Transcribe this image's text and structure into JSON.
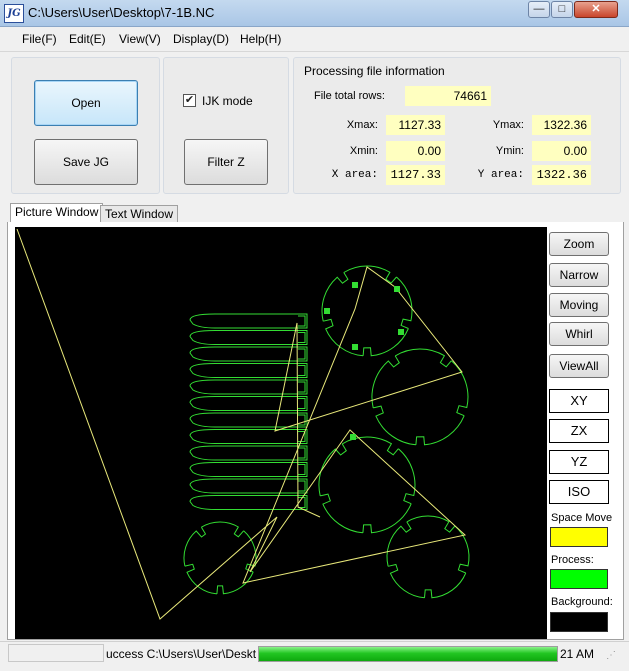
{
  "window": {
    "title": "C:\\Users\\User\\Desktop\\7-1B.NC",
    "app_icon_text": "JG",
    "minimize_glyph": "—",
    "maximize_glyph": "□",
    "close_glyph": "✕"
  },
  "menu": {
    "file": "File(F)",
    "edit": "Edit(E)",
    "view": "View(V)",
    "display": "Display(D)",
    "help": "Help(H)"
  },
  "actions": {
    "open": "Open",
    "save_jg": "Save JG",
    "ijk_mode": "IJK mode",
    "ijk_checked": true,
    "filter_z": "Filter Z"
  },
  "file_info": {
    "heading": "Processing file information",
    "total_rows_label": "File total rows:",
    "total_rows": "74661",
    "xmax_label": "Xmax:",
    "xmax": "1127.33",
    "ymax_label": "Ymax:",
    "ymax": "1322.36",
    "xmin_label": "Xmin:",
    "xmin": "0.00",
    "ymin_label": "Ymin:",
    "ymin": "0.00",
    "xarea_label": "X area:",
    "xarea": "1127.33",
    "yarea_label": "Y area:",
    "yarea": "1322.36"
  },
  "tabs": {
    "picture": "Picture Window",
    "text": "Text Window"
  },
  "side_panel": {
    "zoom": "Zoom",
    "narrow": "Narrow",
    "moving": "Moving",
    "whirl": "Whirl",
    "view_all": "ViewAll",
    "xy": "XY",
    "zx": "ZX",
    "yz": "YZ",
    "iso": "ISO",
    "space_move_label": "Space Move",
    "process_label": "Process:",
    "background_label": "Background:"
  },
  "colors": {
    "space_move": "#ffff00",
    "process": "#00ff00",
    "background": "#000000",
    "path_travel": "#e8e87a",
    "path_cut": "#33dd33"
  },
  "status": {
    "message": "uccess  C:\\Users\\User\\Desktop\\",
    "progress": 1.0,
    "time": "21 AM"
  }
}
